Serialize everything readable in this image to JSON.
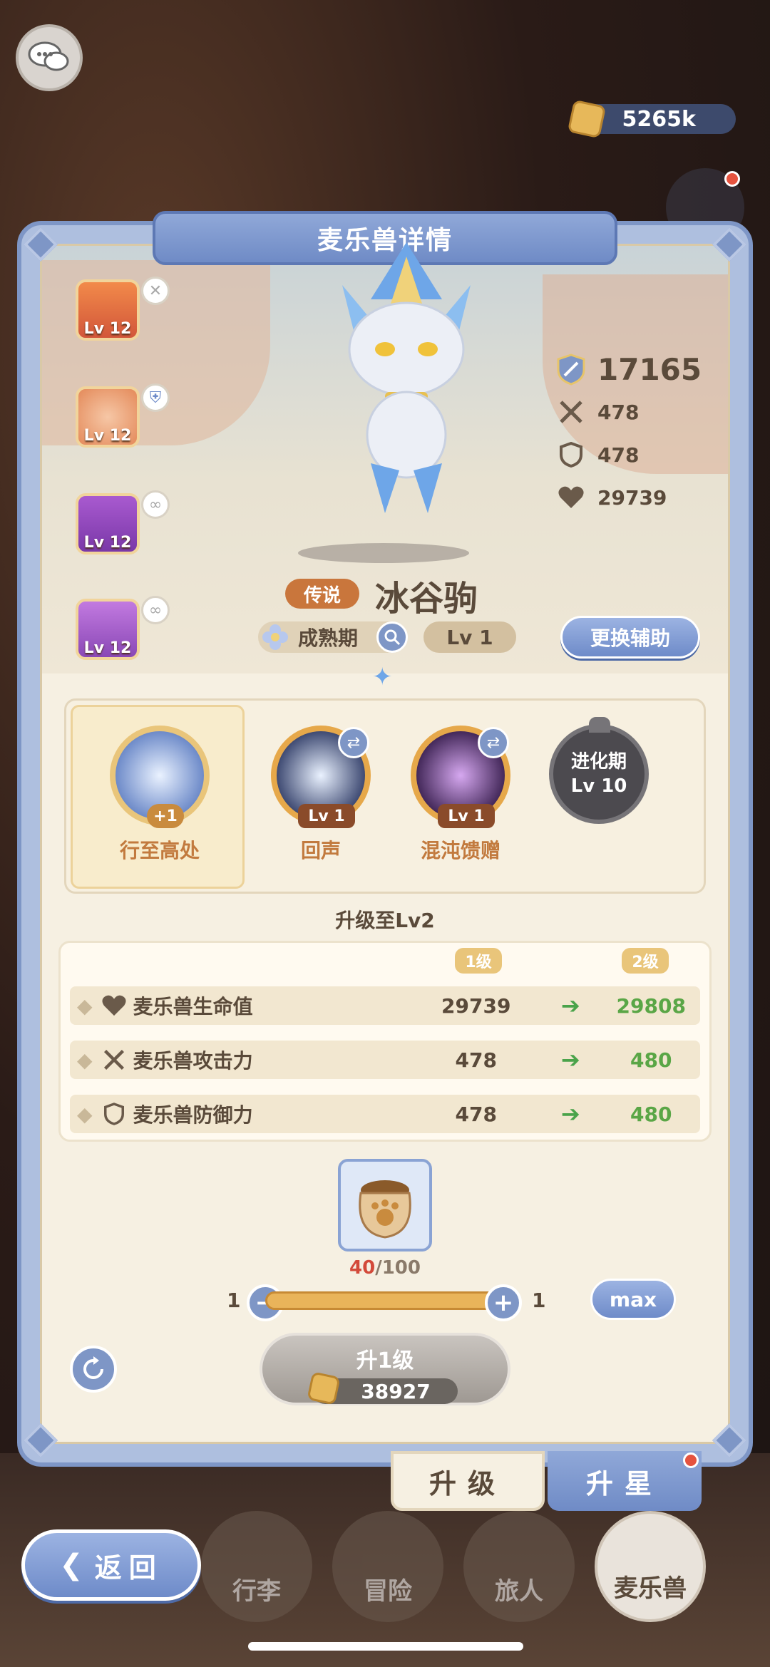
{
  "currency": {
    "amount": "5265k"
  },
  "panel": {
    "title": "麦乐兽详情"
  },
  "slots": [
    {
      "level": "Lv 12",
      "color": "#e0703a",
      "badge": "close-icon"
    },
    {
      "level": "Lv 12",
      "color": "#f0a070",
      "badge": "shield-icon"
    },
    {
      "level": "Lv 12",
      "color": "#9a4cc2",
      "badge": "link-icon"
    },
    {
      "level": "Lv 12",
      "color": "#b063d0",
      "badge": "link-icon"
    }
  ],
  "stats": {
    "power": "17165",
    "attack": "478",
    "defense": "478",
    "hp": "29739"
  },
  "pet": {
    "rarity": "传说",
    "name": "冰谷驹",
    "stage": "成熟期",
    "level": "Lv 1"
  },
  "buttons": {
    "swap_assist": "更换辅助",
    "max": "max",
    "back": "返回"
  },
  "skills": [
    {
      "name": "行至高处",
      "tag": "+1"
    },
    {
      "name": "回声",
      "level": "Lv 1"
    },
    {
      "name": "混沌馈赠",
      "level": "Lv 1"
    }
  ],
  "locked_skill": {
    "line1": "进化期",
    "line2": "Lv 10"
  },
  "upgrade": {
    "title": "升级至Lv2",
    "col_current": "1级",
    "col_next": "2级",
    "rows": [
      {
        "label": "麦乐兽生命值",
        "current": "29739",
        "next": "29808",
        "icon": "heart-icon"
      },
      {
        "label": "麦乐兽攻击力",
        "current": "478",
        "next": "480",
        "icon": "swords-icon"
      },
      {
        "label": "麦乐兽防御力",
        "current": "478",
        "next": "480",
        "icon": "shield-icon"
      }
    ]
  },
  "item": {
    "owned": "40",
    "required": "/100"
  },
  "slider": {
    "min": "1",
    "max": "1"
  },
  "level_up": {
    "label": "升1级",
    "cost": "38927"
  },
  "tabs": {
    "upgrade": "升级",
    "star": "升星"
  },
  "nav": {
    "bag": "行李",
    "adventure": "冒险",
    "traveler": "旅人",
    "pets": "麦乐兽"
  }
}
